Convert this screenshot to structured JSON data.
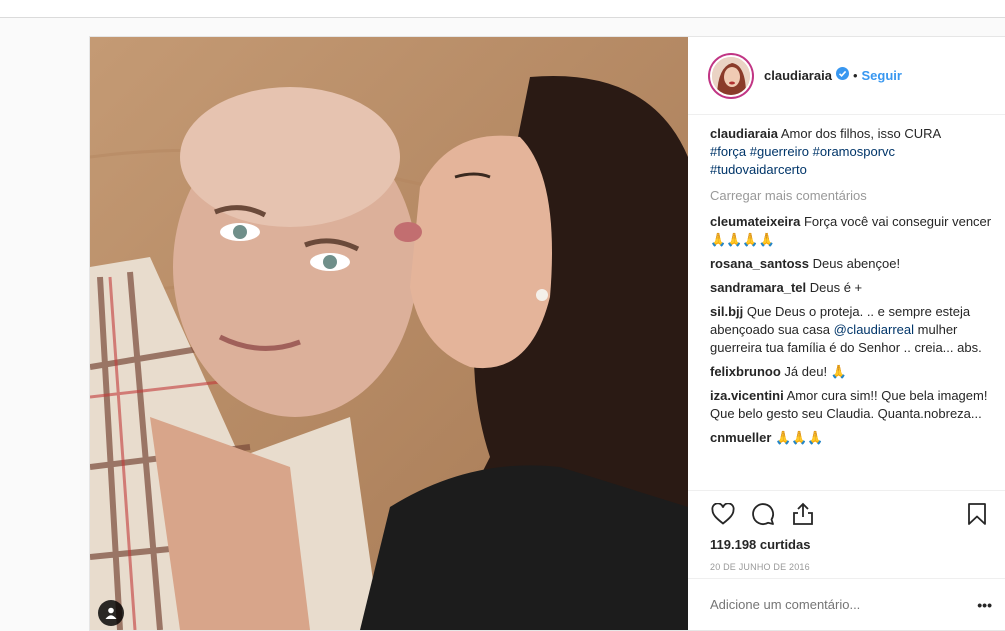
{
  "post": {
    "username": "claudiaraia",
    "dot": "•",
    "follow_label": "Seguir",
    "caption": {
      "user": "claudiaraia",
      "text": "Amor dos filhos, isso CURA",
      "hashtags": [
        "#força",
        "#guerreiro",
        "#oramosporvc",
        "#tudovaidarcerto"
      ]
    },
    "load_more_label": "Carregar mais comentários",
    "comments": [
      {
        "user": "cleumateixeira",
        "text": "Força você vai conseguir vencer",
        "emoji": "🙏🙏🙏🙏"
      },
      {
        "user": "rosana_santoss",
        "text": "Deus abençoe!",
        "emoji": ""
      },
      {
        "user": "sandramara_tel",
        "text": "Deus é +",
        "emoji": ""
      },
      {
        "user": "sil.bjj",
        "text": "Que Deus o proteja. .. e sempre esteja abençoado sua casa",
        "mention": "@claudiarreal",
        "text2": "mulher guerreira tua família é do Senhor .. creia... abs."
      },
      {
        "user": "felixbrunoo",
        "text": "Já deu!",
        "emoji": "🙏"
      },
      {
        "user": "iza.vicentini",
        "text": "Amor cura sim!! Que bela imagem! Que belo gesto seu Claudia. Quanta.nobreza...",
        "emoji": ""
      },
      {
        "user": "cnmueller",
        "text": "",
        "emoji": "🙏🙏🙏"
      }
    ],
    "likes": "119.198 curtidas",
    "date": "20 DE JUNHO DE 2016",
    "add_comment_placeholder": "Adicione um comentário...",
    "more_label": "•••"
  },
  "icons": {
    "like": "heart-icon",
    "comment": "comment-icon",
    "share": "share-icon",
    "save": "bookmark-icon",
    "verified": "verified-badge-icon",
    "tagged": "person-tag-icon"
  },
  "colors": {
    "link": "#3897f0",
    "hashtag": "#003569",
    "verified": "#3897f0",
    "muted": "#999999"
  }
}
